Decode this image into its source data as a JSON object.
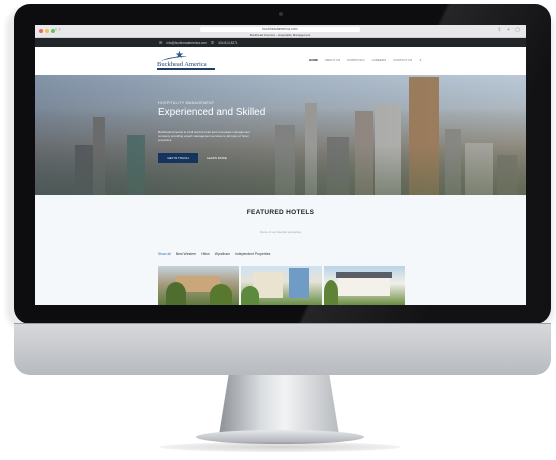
{
  "browser": {
    "address": "buckheadamerica.com",
    "tab_title": "Buckhead America – Hospitality Management"
  },
  "topbar": {
    "email": "info@buckheadamerica.com",
    "phone": "404.814.8271",
    "mail_icon": "mail-icon",
    "phone_icon": "phone-icon"
  },
  "logo": {
    "name": "Buckhead America",
    "icon": "star-icon"
  },
  "nav": {
    "items": [
      "HOME",
      "ABOUT US",
      "PORTFOLIO",
      "CAREERS",
      "CONTACT US"
    ],
    "active": "HOME",
    "search_icon": "search-icon"
  },
  "hero": {
    "kicker": "HOSPITALITY MANAGEMENT",
    "title": "Experienced and Skilled",
    "body": "Buckhead America is a full service hotel and real estate management company providing expert management services to all types of hotel properties.",
    "primary_button": "GET IN TOUCH",
    "secondary_link": "LEARN MORE"
  },
  "featured": {
    "title": "FEATURED HOTELS",
    "subtitle": "Some of our favorite properties",
    "filters": [
      "Show all",
      "Best Western",
      "Hilton",
      "Wyndham",
      "Independent Properties"
    ],
    "active_filter": "Show all"
  },
  "colors": {
    "brand_navy": "#14345e",
    "topbar": "#222629",
    "filter_active": "#2a6fb0"
  }
}
